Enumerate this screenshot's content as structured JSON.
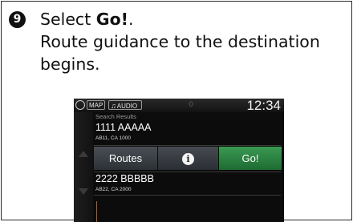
{
  "step": {
    "number": "9",
    "line1_prefix": "Select ",
    "line1_bold": "Go!",
    "line1_suffix": ".",
    "line2": "Route guidance to the destination begins."
  },
  "screen": {
    "topbar": {
      "map_label": "MAP",
      "audio_label": "AUDIO",
      "middle_indicator": "0",
      "clock": "12:34"
    },
    "list_title": "Search Results",
    "results": [
      {
        "name": "1111 AAAAA",
        "address": "AB11, CA 1000"
      },
      {
        "name": "2222 BBBBB",
        "address": "AB22, CA 2000"
      }
    ],
    "actions": {
      "routes_label": "Routes",
      "info_glyph": "i",
      "go_label": "Go!"
    },
    "colors": {
      "go_button": "#2e8a46",
      "screen_bg": "#0c0c0c"
    }
  }
}
